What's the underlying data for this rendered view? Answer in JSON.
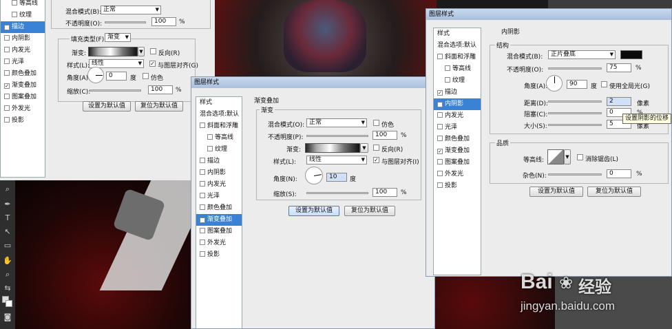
{
  "left_panel": {
    "list": [
      {
        "label": "等高线",
        "checked": false,
        "indent": true
      },
      {
        "label": "纹理",
        "checked": false,
        "indent": true
      },
      {
        "label": "描边",
        "checked": true,
        "selected": true
      },
      {
        "label": "内阴影",
        "checked": false
      },
      {
        "label": "内发光",
        "checked": false
      },
      {
        "label": "光泽",
        "checked": false
      },
      {
        "label": "颜色叠加",
        "checked": false
      },
      {
        "label": "渐变叠加",
        "checked": true
      },
      {
        "label": "图案叠加",
        "checked": false
      },
      {
        "label": "外发光",
        "checked": false
      },
      {
        "label": "投影",
        "checked": false
      }
    ],
    "blend_label": "混合模式(B):",
    "blend_value": "正常",
    "opacity_label": "不透明度(O):",
    "opacity_value": "100",
    "opacity_unit": "%",
    "fill_type_label": "填充类型(F):",
    "fill_type_value": "渐变",
    "gradient_label": "渐变:",
    "reverse_label": "反向(R)",
    "style_label": "样式(L):",
    "style_value": "线性",
    "align_label": "与图层对齐(G)",
    "angle_label": "角度(A):",
    "angle_value": "0",
    "angle_unit": "度",
    "dither_label": "仿色",
    "scale_label": "缩放(C):",
    "scale_value": "100",
    "scale_unit": "%",
    "btn_default": "设置为默认值",
    "btn_reset": "复位为默认值"
  },
  "mid_dialog": {
    "title": "图层样式",
    "list": [
      {
        "label": "样式",
        "type": "header"
      },
      {
        "label": "混合选项:默认",
        "type": "header"
      },
      {
        "label": "斜面和浮雕",
        "checked": false
      },
      {
        "label": "等高线",
        "checked": false,
        "indent": true
      },
      {
        "label": "纹理",
        "checked": false,
        "indent": true
      },
      {
        "label": "描边",
        "checked": false
      },
      {
        "label": "内阴影",
        "checked": false
      },
      {
        "label": "内发光",
        "checked": false
      },
      {
        "label": "光泽",
        "checked": false
      },
      {
        "label": "颜色叠加",
        "checked": false
      },
      {
        "label": "渐变叠加",
        "checked": true,
        "selected": true
      },
      {
        "label": "图案叠加",
        "checked": false
      },
      {
        "label": "外发光",
        "checked": false
      },
      {
        "label": "投影",
        "checked": false
      }
    ],
    "section": "渐变叠加",
    "group": "渐变",
    "blend_label": "混合模式(O):",
    "blend_value": "正常",
    "dither_label": "仿色",
    "opacity_label": "不透明度(P):",
    "opacity_value": "100",
    "opacity_unit": "%",
    "gradient_label": "渐变:",
    "reverse_label": "反向(R)",
    "style_label": "样式(L):",
    "style_value": "线性",
    "align_label": "与图层对齐(I)",
    "angle_label": "角度(N):",
    "angle_value": "10",
    "angle_unit": "度",
    "scale_label": "缩放(S):",
    "scale_value": "100",
    "scale_unit": "%",
    "btn_default": "设置为默认值",
    "btn_reset": "复位为默认值"
  },
  "right_dialog": {
    "title": "图层样式",
    "list": [
      {
        "label": "样式",
        "type": "header"
      },
      {
        "label": "混合选项:默认",
        "type": "header"
      },
      {
        "label": "斜面和浮雕",
        "checked": false
      },
      {
        "label": "等高线",
        "checked": false,
        "indent": true
      },
      {
        "label": "纹理",
        "checked": false,
        "indent": true
      },
      {
        "label": "描边",
        "checked": true
      },
      {
        "label": "内阴影",
        "checked": true,
        "selected": true
      },
      {
        "label": "内发光",
        "checked": false
      },
      {
        "label": "光泽",
        "checked": false
      },
      {
        "label": "颜色叠加",
        "checked": false
      },
      {
        "label": "渐变叠加",
        "checked": true
      },
      {
        "label": "图案叠加",
        "checked": false
      },
      {
        "label": "外发光",
        "checked": false
      },
      {
        "label": "投影",
        "checked": false
      }
    ],
    "section": "内阴影",
    "group1": "结构",
    "blend_label": "混合模式(B):",
    "blend_value": "正片叠底",
    "shadow_color": "#0a0a0a",
    "opacity_label": "不透明度(O):",
    "opacity_value": "75",
    "opacity_unit": "%",
    "angle_label": "角度(A):",
    "angle_value": "90",
    "angle_unit": "度",
    "global_light_label": "使用全局光(G)",
    "distance_label": "距离(D):",
    "distance_value": "2",
    "distance_unit": "像素",
    "choke_label": "阻塞(C):",
    "choke_value": "0",
    "choke_unit": "%",
    "size_label": "大小(S):",
    "size_value": "5",
    "size_unit": "像素",
    "tooltip": "设置阴影的位移",
    "group2": "品质",
    "contour_label": "等高线:",
    "antialias_label": "消除锯齿(L)",
    "noise_label": "杂色(N):",
    "noise_value": "0",
    "noise_unit": "%",
    "btn_default": "设置为默认值",
    "btn_reset": "复位为默认值"
  },
  "watermark": {
    "brand": "Bai",
    "brand2": "经验",
    "url": "jingyan.baidu.com"
  }
}
